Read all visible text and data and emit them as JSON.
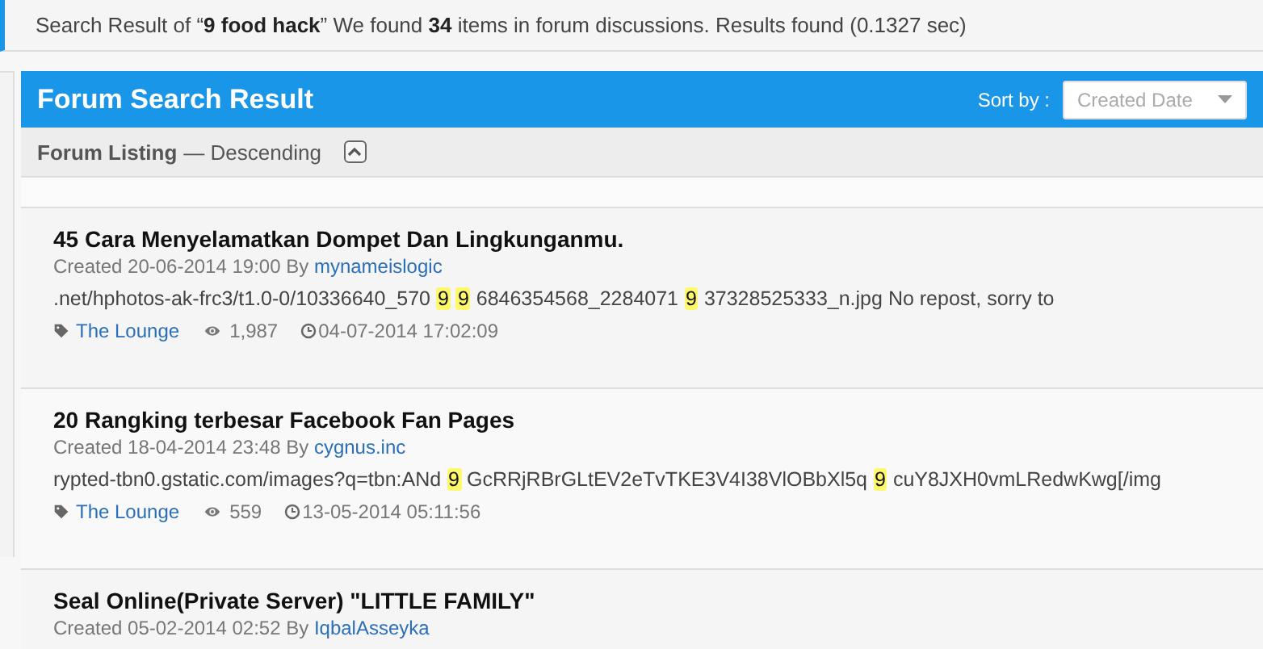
{
  "search_summary": "Search Result of “**9 food hack**” We found **34** items in forum discussions. Results found (0.1327 sec)",
  "panel": {
    "title": "Forum Search Result",
    "sort_label": "Sort by :",
    "sort_value": "Created Date"
  },
  "listing": {
    "label": "Forum Listing",
    "order": "— Descending"
  },
  "results": [
    {
      "title": "45 Cara Menyelamatkan Dompet Dan Lingkunganmu.",
      "created": "Created 20-06-2014 19:00 By",
      "author": "mynameislogic",
      "snippet": [
        {
          "text": ".net/hphotos-ak-frc3/t1.0-0/10336640_570",
          "hit": false
        },
        {
          "text": "9",
          "hit": true
        },
        {
          "text": "9",
          "hit": true
        },
        {
          "text": "6846354568_2284071",
          "hit": false
        },
        {
          "text": "9",
          "hit": true
        },
        {
          "text": "37328525333_n.jpg No repost, sorry to",
          "hit": false
        }
      ],
      "forum": "The Lounge",
      "views": "1,987",
      "updated": "04-07-2014 17:02:09"
    },
    {
      "title": "20 Rangking terbesar Facebook Fan Pages",
      "created": "Created 18-04-2014 23:48 By",
      "author": "cygnus.inc",
      "snippet": [
        {
          "text": "rypted-tbn0.gstatic.com/images?q=tbn:ANd",
          "hit": false
        },
        {
          "text": "9",
          "hit": true
        },
        {
          "text": "GcRRjRBrGLtEV2eTvTKE3V4I38VlOBbXl5q",
          "hit": false
        },
        {
          "text": "9",
          "hit": true
        },
        {
          "text": "cuY8JXH0vmLRedwKwg[/img",
          "hit": false
        }
      ],
      "forum": "The Lounge",
      "views": "559",
      "updated": "13-05-2014 05:11:56"
    },
    {
      "title": "Seal Online(Private Server) \"LITTLE FAMILY\"",
      "created": "Created 05-02-2014 02:52 By",
      "author": "IqbalAsseyka"
    }
  ]
}
